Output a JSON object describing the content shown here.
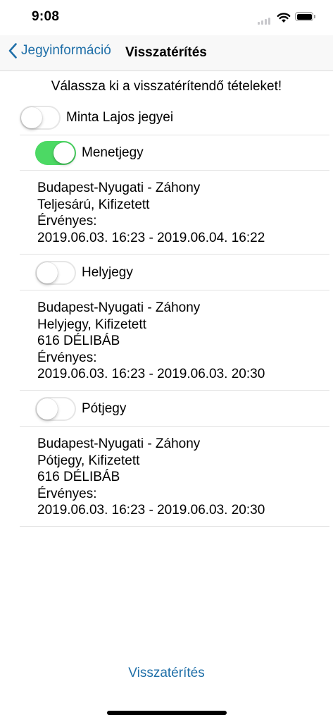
{
  "status_bar": {
    "time": "9:08"
  },
  "nav": {
    "back_label": "Jegyinformáció",
    "title": "Visszatérítés"
  },
  "instruction": "Válassza ki a visszatérítendő tételeket!",
  "passenger": {
    "label": "Minta Lajos jegyei",
    "selected": false
  },
  "tickets": [
    {
      "label": "Menetjegy",
      "selected": true,
      "lines": [
        "Budapest-Nyugati - Záhony",
        "Teljesárú, Kifizetett",
        "Érvényes:",
        "2019.06.03. 16:23 - 2019.06.04. 16:22"
      ]
    },
    {
      "label": "Helyjegy",
      "selected": false,
      "lines": [
        "Budapest-Nyugati - Záhony",
        "Helyjegy, Kifizetett",
        "616 DÉLIBÁB",
        "Érvényes:",
        "2019.06.03. 16:23 - 2019.06.03. 20:30"
      ]
    },
    {
      "label": "Pótjegy",
      "selected": false,
      "lines": [
        "Budapest-Nyugati - Záhony",
        "Pótjegy, Kifizetett",
        "616 DÉLIBÁB",
        "Érvényes:",
        "2019.06.03. 16:23 - 2019.06.03. 20:30"
      ]
    }
  ],
  "refund_button": "Visszatérítés",
  "colors": {
    "accent": "#1f6fa8",
    "toggle_on": "#4cd964"
  },
  "icons": {
    "back": "chevron-left-icon",
    "wifi": "wifi-icon",
    "battery": "battery-icon",
    "signal": "cellular-signal-icon"
  }
}
